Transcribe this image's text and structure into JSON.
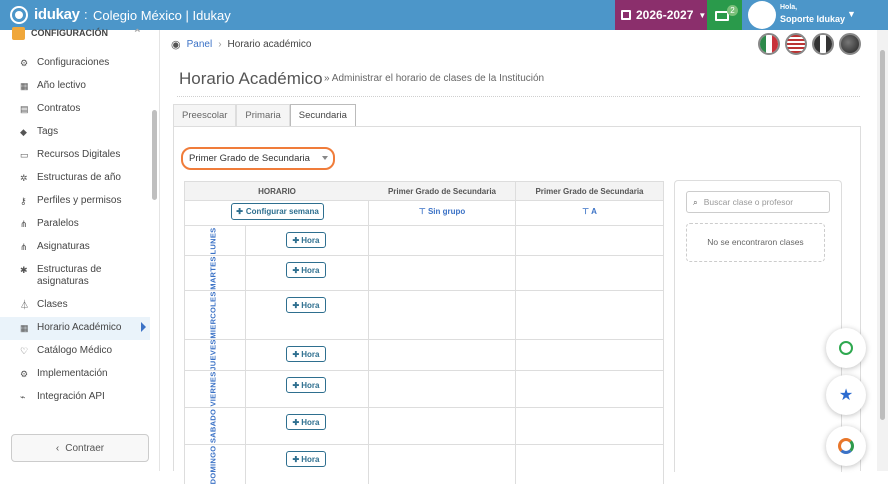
{
  "topbar": {
    "brand": "idukay",
    "separator": ":",
    "title": "Colegio México | Idukay",
    "year": "2026-2027",
    "msg_badge": "2",
    "user_greeting": "Hola,",
    "user_name": "Soporte Idukay"
  },
  "colors": {
    "topbar": "#4c96c9",
    "year": "#8b2f6c",
    "messages": "#2a9a4b",
    "accent_orange": "#f07c3a",
    "link": "#3b72c6"
  },
  "sidebar": {
    "header": "CONFIGURACIÓN",
    "items": [
      {
        "label": "Configuraciones",
        "icon": "gears-icon"
      },
      {
        "label": "Año lectivo",
        "icon": "calendar-icon"
      },
      {
        "label": "Contratos",
        "icon": "document-icon"
      },
      {
        "label": "Tags",
        "icon": "tag-icon"
      },
      {
        "label": "Recursos Digitales",
        "icon": "laptop-icon"
      },
      {
        "label": "Estructuras de año",
        "icon": "gear-icon"
      },
      {
        "label": "Perfiles y permisos",
        "icon": "key-icon"
      },
      {
        "label": "Paralelos",
        "icon": "sitemap-icon"
      },
      {
        "label": "Asignaturas",
        "icon": "sitemap-icon"
      },
      {
        "label": "Estructuras de asignaturas",
        "icon": "asterisk-icon"
      },
      {
        "label": "Clases",
        "icon": "flask-icon"
      },
      {
        "label": "Horario Académico",
        "icon": "calendar-icon",
        "active": true
      },
      {
        "label": "Catálogo Médico",
        "icon": "stethoscope-icon"
      },
      {
        "label": "Implementación",
        "icon": "gears-icon"
      },
      {
        "label": "Integración API",
        "icon": "plug-icon"
      }
    ],
    "collapse": "Contraer"
  },
  "breadcrumb": {
    "home": "Panel",
    "current": "Horario académico"
  },
  "page": {
    "title": "Horario Académico",
    "subtitle": "» Administrar el horario de clases de la Institución"
  },
  "tabs": [
    "Preescolar",
    "Primaria",
    "Secundaria"
  ],
  "select": {
    "value": "Primer Grado de Secundaria"
  },
  "schedule": {
    "horario": "HORARIO",
    "configure": "Configurar semana",
    "add_hour": "Hora",
    "columns": [
      {
        "title": "Primer Grado de Secundaria",
        "group": "Sin grupo"
      },
      {
        "title": "Primer Grado de Secundaria",
        "group": "A"
      }
    ],
    "days": [
      "LUNES",
      "MARTES",
      "MIERCOLES",
      "JUEVES",
      "VIERNES",
      "SABADO",
      "DOMINGO"
    ]
  },
  "search": {
    "placeholder": "Buscar clase o profesor",
    "empty": "No se encontraron clases"
  }
}
